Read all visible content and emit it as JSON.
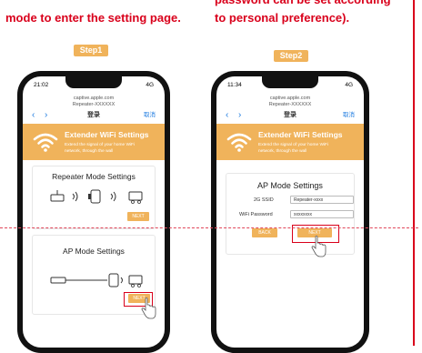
{
  "captions": {
    "left": "mode to enter the setting page.",
    "right_line1": "password can be set according",
    "right_line2": "to personal preference)."
  },
  "steps": {
    "step1": "Step1",
    "step2": "Step2"
  },
  "phone1": {
    "time": "21:02",
    "signal": "4G",
    "url_line1": "captive.apple.com",
    "url_line2": "Repeater-XXXXXX",
    "nav_title": "登录",
    "nav_cancel": "取消",
    "banner_title": "Extender WiFi Settings",
    "banner_desc": "Extend the signal of your home WiFi network, through the wall",
    "repeater_title": "Repeater Mode Settings",
    "repeater_next": "NEXT",
    "ap_title": "AP Mode Settings",
    "ap_next": "NEXT"
  },
  "phone2": {
    "time": "11:34",
    "signal": "4G",
    "url_line1": "captive.apple.com",
    "url_line2": "Repeater-XXXXXX",
    "nav_title": "登录",
    "nav_cancel": "取消",
    "banner_title": "Extender WiFi Settings",
    "banner_desc": "Extend the signal of your home WiFi network, through the wall",
    "ap_title": "AP Mode Settings",
    "ssid_label": "2G SSID",
    "ssid_value": "Repeater-xxxx",
    "pwd_label": "WiFi Password",
    "pwd_value": "xxxxxxxx",
    "back_label": "BACK",
    "next_label": "NEXT"
  },
  "colors": {
    "accent": "#f0b35b",
    "red": "#d9001b",
    "link": "#1e7be0"
  }
}
